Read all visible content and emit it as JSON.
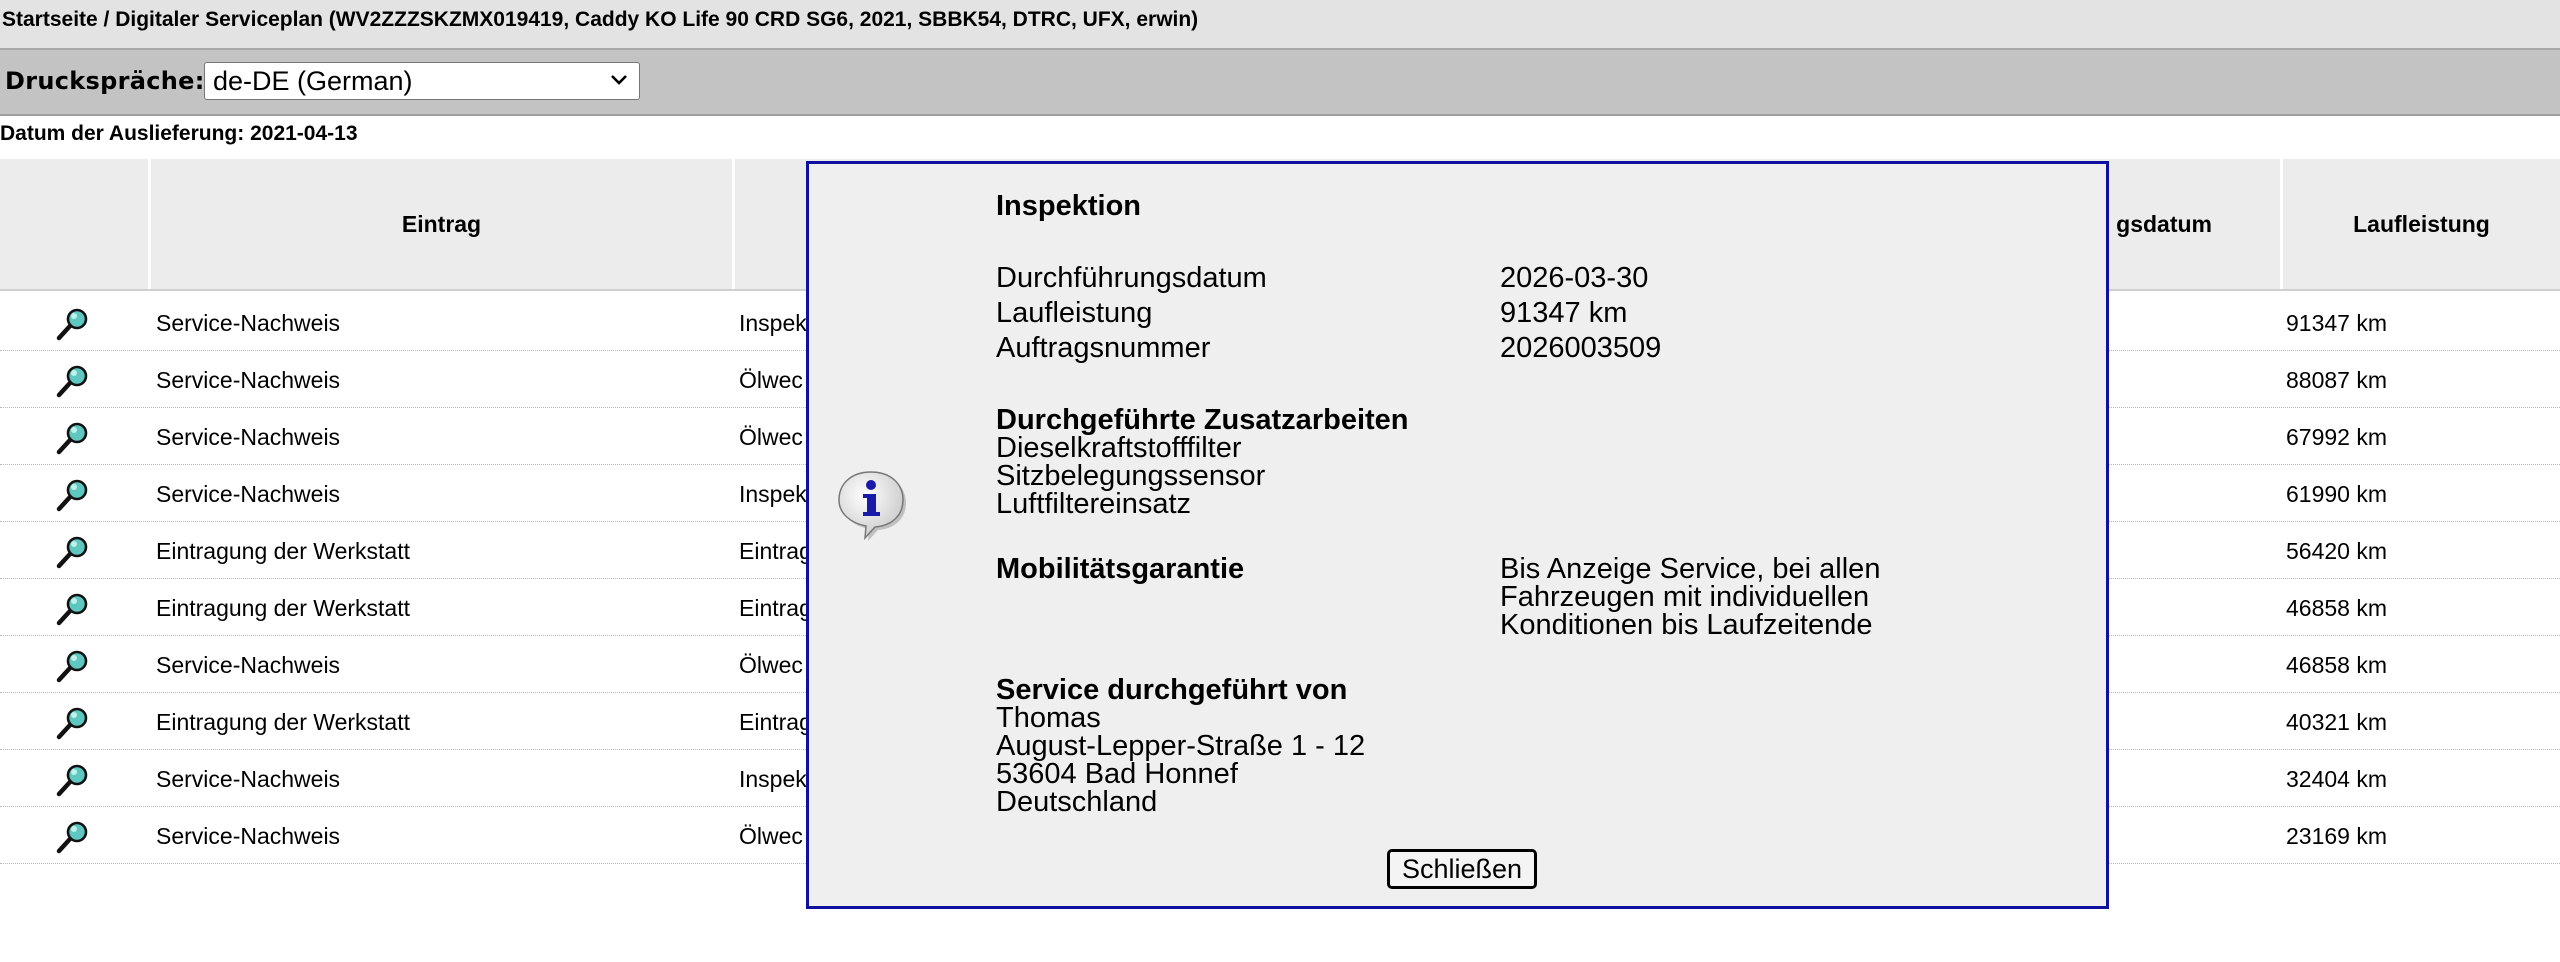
{
  "breadcrumb": "Startseite / Digitaler Serviceplan (WV2ZZZSKZMX019419, Caddy KO Life 90 CRD SG6, 2021, SBBK54, DTRC, UFX, erwin)",
  "print_language": {
    "label": "Druckspräche:",
    "selected": "de-DE (German)"
  },
  "delivery_date": "Datum der Auslieferung: 2021-04-13",
  "table": {
    "headers": {
      "entry": "Eintrag",
      "date_partial": "gsdatum",
      "mileage": "Laufleistung"
    },
    "rows": [
      {
        "entry": "Service-Nachweis",
        "type": "Inspek",
        "mileage": "91347 km"
      },
      {
        "entry": "Service-Nachweis",
        "type": "Ölwec",
        "mileage": "88087 km"
      },
      {
        "entry": "Service-Nachweis",
        "type": "Ölwec",
        "mileage": "67992 km"
      },
      {
        "entry": "Service-Nachweis",
        "type": "Inspek",
        "mileage": "61990 km"
      },
      {
        "entry": "Eintragung der Werkstatt",
        "type": "Eintrag",
        "mileage": "56420 km"
      },
      {
        "entry": "Eintragung der Werkstatt",
        "type": "Eintrag",
        "mileage": "46858 km"
      },
      {
        "entry": "Service-Nachweis",
        "type": "Ölwec",
        "mileage": "46858 km"
      },
      {
        "entry": "Eintragung der Werkstatt",
        "type": "Eintrag",
        "mileage": "40321 km"
      },
      {
        "entry": "Service-Nachweis",
        "type": "Inspek",
        "mileage": "32404 km"
      },
      {
        "entry": "Service-Nachweis",
        "type": "Ölwec",
        "mileage": "23169 km"
      }
    ]
  },
  "dialog": {
    "title": "Inspektion",
    "fields": [
      {
        "label": "Durchführungsdatum",
        "value": "2026-03-30"
      },
      {
        "label": "Laufleistung",
        "value": "91347 km"
      },
      {
        "label": "Auftragsnummer",
        "value": "2026003509"
      }
    ],
    "extra_work": {
      "heading": "Durchgeführte Zusatzarbeiten",
      "items": [
        "Dieselkraftstofffilter",
        "Sitzbelegungssensor",
        "Luftfiltereinsatz"
      ]
    },
    "mobility": {
      "heading": "Mobilitätsgarantie",
      "lines": [
        "Bis Anzeige Service, bei allen",
        "Fahrzeugen mit individuellen",
        "Konditionen bis Laufzeitende"
      ]
    },
    "performed_by": {
      "heading": "Service durchgeführt von",
      "lines": [
        "Thomas",
        "August-Lepper-Straße 1 - 12",
        "53604 Bad Honnef",
        "Deutschland"
      ]
    },
    "close_label": "Schließen"
  },
  "colors": {
    "dialog_border": "#1010a0",
    "header_bg": "#ececec",
    "magnifier": "#5ec8c0"
  },
  "icons": {
    "row_action": "magnifier-icon",
    "dialog_info": "info-bubble-icon"
  }
}
